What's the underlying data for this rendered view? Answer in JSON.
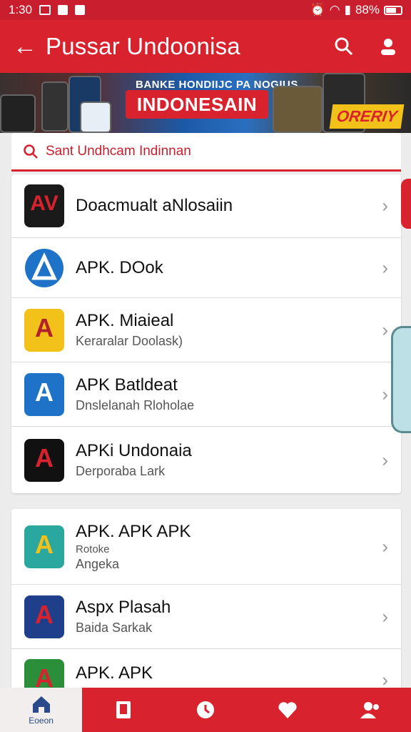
{
  "status_bar": {
    "time": "1:30",
    "battery": "88%"
  },
  "app_bar": {
    "title": "Pussar Undoonisa"
  },
  "banner": {
    "headline": "BANKE HONDIIJC PA NOGIUS",
    "title": "INDONESAIN",
    "tag": "ORERIY"
  },
  "search": {
    "text": "Sant Undhcam Indinnan"
  },
  "list_one": [
    {
      "title": "Doacmualt aNlosaiin",
      "subtitle": "",
      "icon": "dark-av-icon",
      "bg": "#1a1a1a"
    },
    {
      "title": "APK. DOok",
      "subtitle": "",
      "icon": "blue-a-icon",
      "bg": "#1e73c8"
    },
    {
      "title": "APK. Miaieal",
      "subtitle": "Keraralar Doolask)",
      "icon": "yellow-a-icon",
      "bg": "#f2c21a"
    },
    {
      "title": "APK Batldeat",
      "subtitle": "Dnslelanah Rloholae",
      "icon": "blue-white-a-icon",
      "bg": "#1e73c8"
    },
    {
      "title": "APKi Undonaia",
      "subtitle": "Derporaba Lark",
      "icon": "black-a-icon",
      "bg": "#111111"
    }
  ],
  "list_two": [
    {
      "title": "APK. APK APK",
      "sub1": "Rotoke",
      "sub2": "Angeka",
      "icon": "teal-a-icon",
      "bg": "#2aa8a0"
    },
    {
      "title": "Aspx Plasah",
      "sub1": "",
      "sub2": "Baida Sarkak",
      "icon": "navy-a-icon",
      "bg": "#1f3f8a"
    },
    {
      "title": "APK. APK",
      "sub1": "",
      "sub2": "",
      "icon": "green-a-icon",
      "bg": "#2b8f3a"
    }
  ],
  "bottom_nav": [
    {
      "label": "Eoeon",
      "icon": "home-icon",
      "active": true
    },
    {
      "label": "",
      "icon": "book-icon",
      "active": false
    },
    {
      "label": "",
      "icon": "clock-icon",
      "active": false
    },
    {
      "label": "",
      "icon": "heart-icon",
      "active": false
    },
    {
      "label": "",
      "icon": "user-icon",
      "active": false
    }
  ],
  "colors": {
    "primary": "#d8232f",
    "background": "#ececec"
  }
}
